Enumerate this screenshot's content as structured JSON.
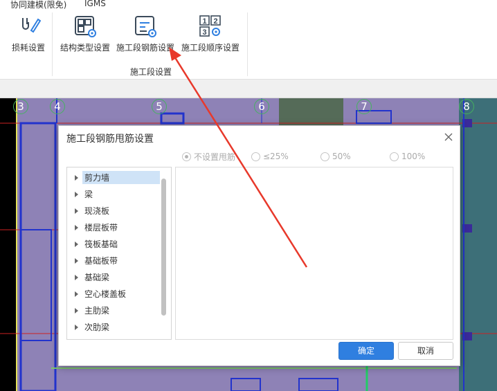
{
  "menubar": {
    "items": [
      "协同建模(限免)",
      "IGMS"
    ]
  },
  "ribbon": {
    "buttons": [
      {
        "label": "损耗设置",
        "icon": "loss-settings-icon"
      },
      {
        "label": "结构类型设置",
        "icon": "structure-type-settings-icon"
      },
      {
        "label": "施工段钢筋设置",
        "icon": "segment-rebar-settings-icon"
      },
      {
        "label": "施工段顺序设置",
        "icon": "segment-order-settings-icon"
      }
    ],
    "order_icon_digits": [
      "1",
      "2",
      "3"
    ],
    "group_label": "施工段设置"
  },
  "canvas": {
    "axis_labels": [
      "3",
      "4",
      "5",
      "6",
      "7",
      "8"
    ]
  },
  "dialog": {
    "title": "施工段钢筋甩筋设置",
    "close_icon": "close-icon",
    "radio_options": [
      {
        "label": "不设置甩筋",
        "checked": true
      },
      {
        "label": "≤25%",
        "checked": false
      },
      {
        "label": "50%",
        "checked": false
      },
      {
        "label": "100%",
        "checked": false
      }
    ],
    "tree_items": [
      {
        "label": "剪力墙",
        "selected": true
      },
      {
        "label": "梁"
      },
      {
        "label": "现浇板"
      },
      {
        "label": "楼层板带"
      },
      {
        "label": "筏板基础"
      },
      {
        "label": "基础板带"
      },
      {
        "label": "基础梁"
      },
      {
        "label": "空心楼盖板"
      },
      {
        "label": "主肋梁"
      },
      {
        "label": "次肋梁"
      }
    ],
    "ok_label": "确定",
    "cancel_label": "取消"
  },
  "colors": {
    "accent": "#2f7fe0",
    "canvas_bg": "#8e82b6",
    "annotation_arrow": "#e8392b",
    "axis_bubble_border": "#45b25f"
  }
}
